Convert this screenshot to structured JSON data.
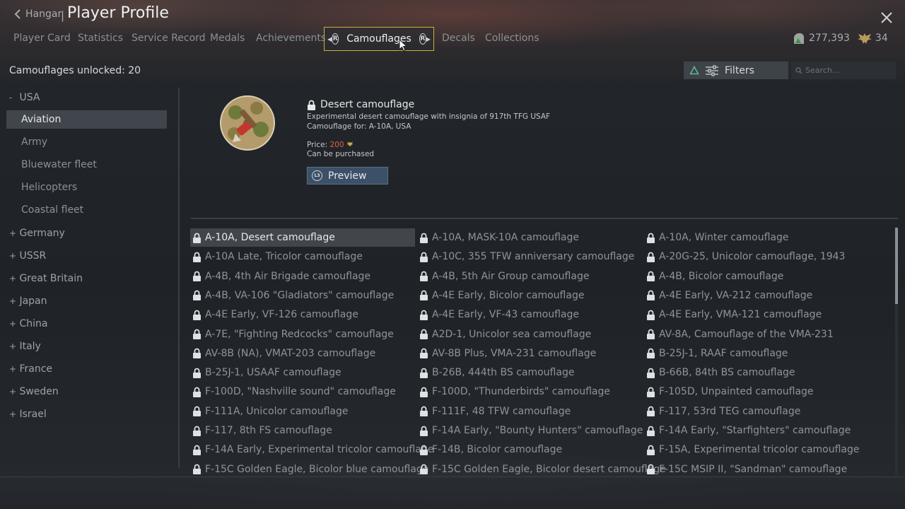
{
  "header": {
    "back_label": "Hangar",
    "separator": "|",
    "title": "Player Profile"
  },
  "tabs": [
    {
      "label": "Player Card"
    },
    {
      "label": "Statistics"
    },
    {
      "label": "Service Record"
    },
    {
      "label": "Medals"
    },
    {
      "label": "Achievements"
    },
    {
      "label": "Camouflages",
      "active": true
    },
    {
      "label": "Decals"
    },
    {
      "label": "Collections"
    }
  ],
  "tab_button_glyph": "R",
  "currency": {
    "silver_lions": "277,393",
    "golden_eagles": "34"
  },
  "unlocked_text": "Camouflages unlocked: 20",
  "filters": {
    "label": "Filters"
  },
  "search": {
    "placeholder": "Search..."
  },
  "sidebar": {
    "nations": [
      {
        "sign": "-",
        "label": "USA",
        "expanded": true
      },
      {
        "sign": "+",
        "label": "Germany"
      },
      {
        "sign": "+",
        "label": "USSR"
      },
      {
        "sign": "+",
        "label": "Great Britain"
      },
      {
        "sign": "+",
        "label": "Japan"
      },
      {
        "sign": "+",
        "label": "China"
      },
      {
        "sign": "+",
        "label": "Italy"
      },
      {
        "sign": "+",
        "label": "France"
      },
      {
        "sign": "+",
        "label": "Sweden"
      },
      {
        "sign": "+",
        "label": "Israel"
      }
    ],
    "usa_sub": [
      {
        "label": "Aviation",
        "active": true
      },
      {
        "label": "Army"
      },
      {
        "label": "Bluewater fleet"
      },
      {
        "label": "Helicopters"
      },
      {
        "label": "Coastal fleet"
      }
    ]
  },
  "detail": {
    "title": "Desert camouflage",
    "description": "Experimental desert camouflage with insignia of 917th TFG USAF",
    "camouflage_for": "Camouflage for: A-10A, USA",
    "price_label": "Price: ",
    "price_value": "200",
    "purchase_note": "Can be purchased",
    "preview_label": "Preview",
    "preview_key": "L3"
  },
  "camouflages": {
    "col1": [
      "A-10A, Desert camouflage",
      "A-10A Late, Tricolor camouflage",
      "A-4B, 4th Air Brigade camouflage",
      "A-4B, VA-106 \"Gladiators\" camouflage",
      "A-4E Early, VF-126 camouflage",
      "A-7E, \"Fighting Redcocks\" camouflage",
      "AV-8B (NA), VMAT-203 camouflage",
      "B-25J-1, USAAF camouflage",
      "F-100D, \"Nashville sound\" camouflage",
      "F-111A, Unicolor camouflage",
      "F-117, 8th FS camouflage",
      "F-14A Early, Experimental tricolor camouflage",
      "F-15C Golden Eagle, Bicolor blue camouflage"
    ],
    "col2": [
      "A-10A, MASK-10A camouflage",
      "A-10C, 355 TFW anniversary camouflage",
      "A-4B, 5th Air Group camouflage",
      "A-4E Early, Bicolor camouflage",
      "A-4E Early, VF-43 camouflage",
      "A2D-1, Unicolor sea camouflage",
      "AV-8B Plus, VMA-231 camouflage",
      "B-26B, 444th BS camouflage",
      "F-100D, \"Thunderbirds\" camouflage",
      "F-111F, 48 TFW camouflage",
      "F-14A Early, \"Bounty Hunters\" camouflage",
      "F-14B, Bicolor camouflage",
      "F-15C Golden Eagle, Bicolor desert camouflage"
    ],
    "col3": [
      "A-10A, Winter camouflage",
      "A-20G-25, Unicolor camouflage, 1943",
      "A-4B, Bicolor camouflage",
      "A-4E Early, VA-212 camouflage",
      "A-4E Early, VMA-121 camouflage",
      "AV-8A, Camouflage of the VMA-231",
      "B-25J-1, RAAF camouflage",
      "B-66B, 84th BS camouflage",
      "F-105D, Unpainted camouflage",
      "F-117, 53rd TEG camouflage",
      "F-14A Early, \"Starfighters\" camouflage",
      "F-15A, Experimental tricolor camouflage",
      "F-15C MSIP II, \"Sandman\" camouflage"
    ]
  }
}
